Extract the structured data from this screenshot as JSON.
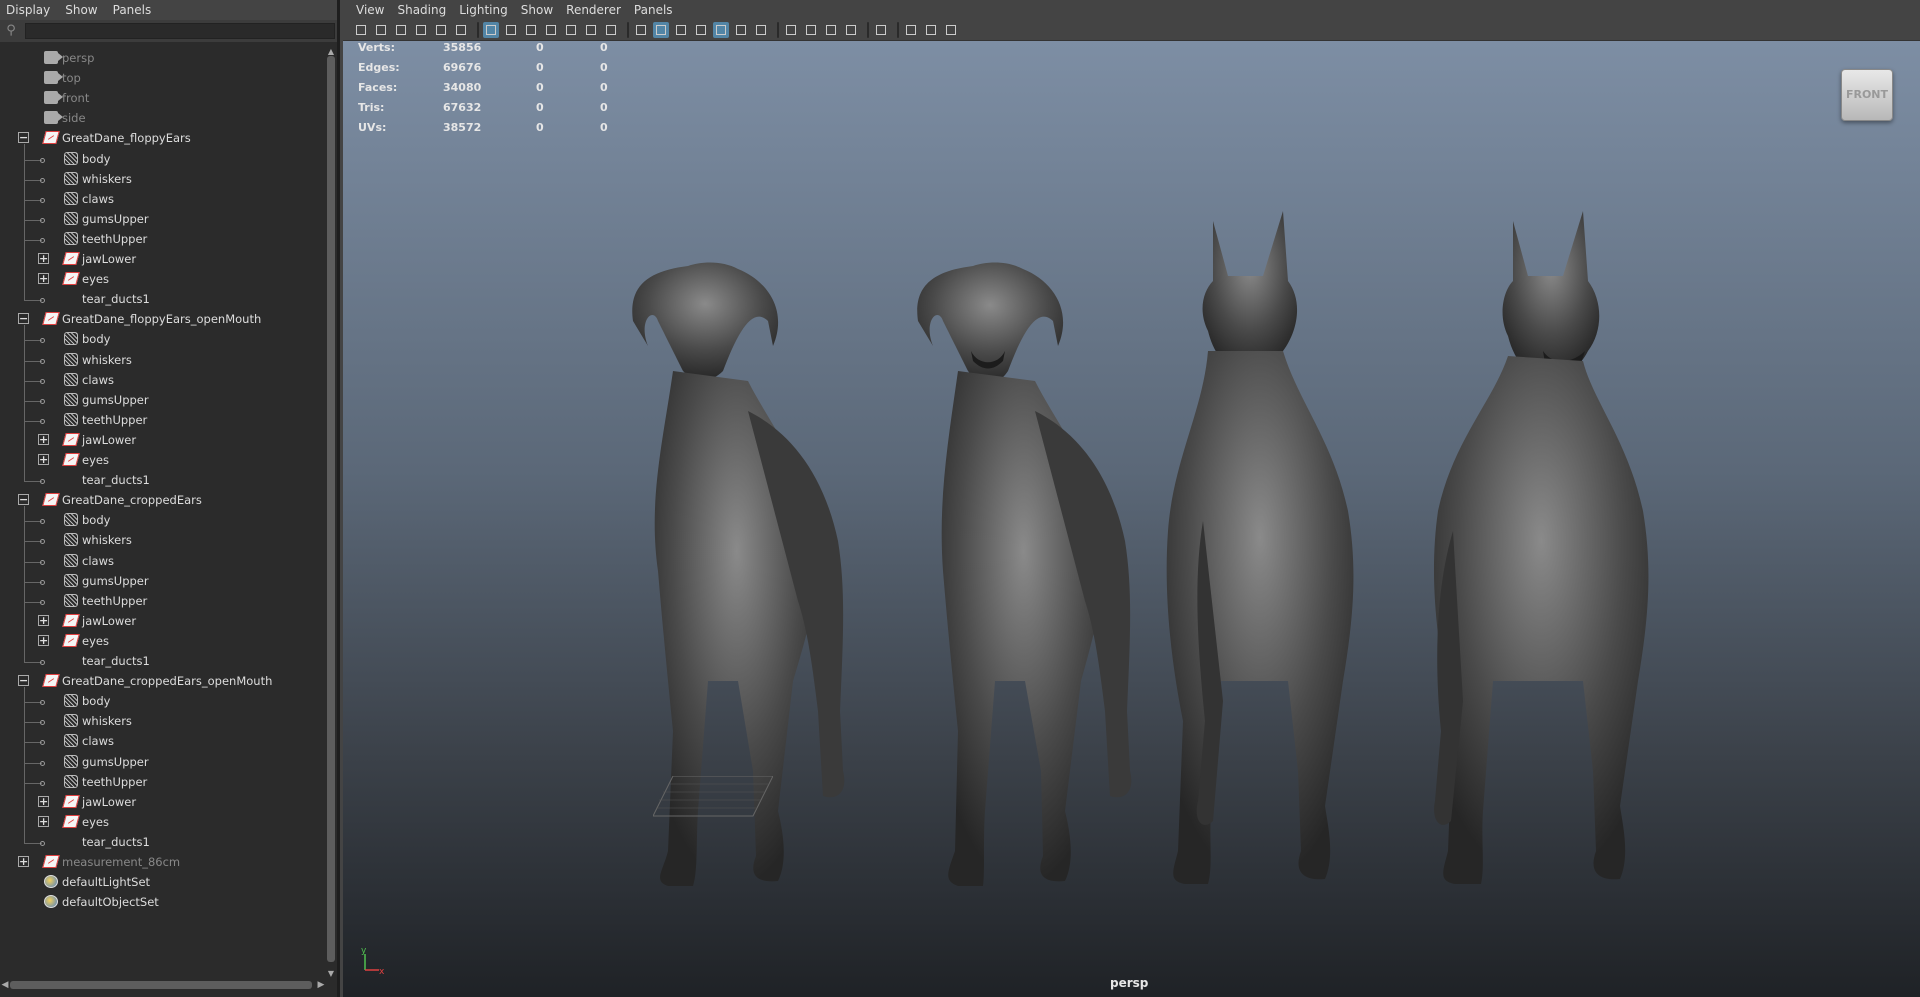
{
  "outliner": {
    "menu": [
      "Display",
      "Show",
      "Panels"
    ],
    "filter_placeholder": "",
    "items": [
      {
        "label": "persp",
        "icon": "camera-icon",
        "indent": 0,
        "expander": "",
        "grey": true
      },
      {
        "label": "top",
        "icon": "camera-icon",
        "indent": 0,
        "expander": "",
        "grey": true
      },
      {
        "label": "front",
        "icon": "camera-icon",
        "indent": 0,
        "expander": "",
        "grey": true
      },
      {
        "label": "side",
        "icon": "camera-icon",
        "indent": 0,
        "expander": "",
        "grey": true
      },
      {
        "label": "GreatDane_floppyEars",
        "icon": "transform-icon",
        "indent": 0,
        "expander": "−",
        "grey": false
      },
      {
        "label": "body",
        "icon": "mesh-icon",
        "indent": 1,
        "expander": "",
        "grey": false
      },
      {
        "label": "whiskers",
        "icon": "mesh-icon",
        "indent": 1,
        "expander": "",
        "grey": false
      },
      {
        "label": "claws",
        "icon": "mesh-icon",
        "indent": 1,
        "expander": "",
        "grey": false
      },
      {
        "label": "gumsUpper",
        "icon": "mesh-icon",
        "indent": 1,
        "expander": "",
        "grey": false
      },
      {
        "label": "teethUpper",
        "icon": "mesh-icon",
        "indent": 1,
        "expander": "",
        "grey": false
      },
      {
        "label": "jawLower",
        "icon": "transform-icon",
        "indent": 1,
        "expander": "+",
        "grey": false
      },
      {
        "label": "eyes",
        "icon": "transform-icon",
        "indent": 1,
        "expander": "+",
        "grey": false
      },
      {
        "label": "tear_ducts1",
        "icon": "",
        "indent": 1,
        "expander": "",
        "grey": false
      },
      {
        "label": "GreatDane_floppyEars_openMouth",
        "icon": "transform-icon",
        "indent": 0,
        "expander": "−",
        "grey": false
      },
      {
        "label": "body",
        "icon": "mesh-icon",
        "indent": 1,
        "expander": "",
        "grey": false
      },
      {
        "label": "whiskers",
        "icon": "mesh-icon",
        "indent": 1,
        "expander": "",
        "grey": false
      },
      {
        "label": "claws",
        "icon": "mesh-icon",
        "indent": 1,
        "expander": "",
        "grey": false
      },
      {
        "label": "gumsUpper",
        "icon": "mesh-icon",
        "indent": 1,
        "expander": "",
        "grey": false
      },
      {
        "label": "teethUpper",
        "icon": "mesh-icon",
        "indent": 1,
        "expander": "",
        "grey": false
      },
      {
        "label": "jawLower",
        "icon": "transform-icon",
        "indent": 1,
        "expander": "+",
        "grey": false
      },
      {
        "label": "eyes",
        "icon": "transform-icon",
        "indent": 1,
        "expander": "+",
        "grey": false
      },
      {
        "label": "tear_ducts1",
        "icon": "",
        "indent": 1,
        "expander": "",
        "grey": false
      },
      {
        "label": "GreatDane_croppedEars",
        "icon": "transform-icon",
        "indent": 0,
        "expander": "−",
        "grey": false
      },
      {
        "label": "body",
        "icon": "mesh-icon",
        "indent": 1,
        "expander": "",
        "grey": false
      },
      {
        "label": "whiskers",
        "icon": "mesh-icon",
        "indent": 1,
        "expander": "",
        "grey": false
      },
      {
        "label": "claws",
        "icon": "mesh-icon",
        "indent": 1,
        "expander": "",
        "grey": false
      },
      {
        "label": "gumsUpper",
        "icon": "mesh-icon",
        "indent": 1,
        "expander": "",
        "grey": false
      },
      {
        "label": "teethUpper",
        "icon": "mesh-icon",
        "indent": 1,
        "expander": "",
        "grey": false
      },
      {
        "label": "jawLower",
        "icon": "transform-icon",
        "indent": 1,
        "expander": "+",
        "grey": false
      },
      {
        "label": "eyes",
        "icon": "transform-icon",
        "indent": 1,
        "expander": "+",
        "grey": false
      },
      {
        "label": "tear_ducts1",
        "icon": "",
        "indent": 1,
        "expander": "",
        "grey": false
      },
      {
        "label": "GreatDane_croppedEars_openMouth",
        "icon": "transform-icon",
        "indent": 0,
        "expander": "−",
        "grey": false
      },
      {
        "label": "body",
        "icon": "mesh-icon",
        "indent": 1,
        "expander": "",
        "grey": false
      },
      {
        "label": "whiskers",
        "icon": "mesh-icon",
        "indent": 1,
        "expander": "",
        "grey": false
      },
      {
        "label": "claws",
        "icon": "mesh-icon",
        "indent": 1,
        "expander": "",
        "grey": false
      },
      {
        "label": "gumsUpper",
        "icon": "mesh-icon",
        "indent": 1,
        "expander": "",
        "grey": false
      },
      {
        "label": "teethUpper",
        "icon": "mesh-icon",
        "indent": 1,
        "expander": "",
        "grey": false
      },
      {
        "label": "jawLower",
        "icon": "transform-icon",
        "indent": 1,
        "expander": "+",
        "grey": false
      },
      {
        "label": "eyes",
        "icon": "transform-icon",
        "indent": 1,
        "expander": "+",
        "grey": false
      },
      {
        "label": "tear_ducts1",
        "icon": "",
        "indent": 1,
        "expander": "",
        "grey": false
      },
      {
        "label": "measurement_86cm",
        "icon": "transform-icon",
        "indent": 0,
        "expander": "+",
        "grey": true
      },
      {
        "label": "defaultLightSet",
        "icon": "set-icon",
        "indent": 0,
        "expander": "",
        "grey": false
      },
      {
        "label": "defaultObjectSet",
        "icon": "set-icon",
        "indent": 0,
        "expander": "",
        "grey": false
      }
    ]
  },
  "viewport": {
    "menu": [
      "View",
      "Shading",
      "Lighting",
      "Show",
      "Renderer",
      "Panels"
    ],
    "hud": [
      {
        "label": "Verts:",
        "v1": "35856",
        "v2": "0",
        "v3": "0"
      },
      {
        "label": "Edges:",
        "v1": "69676",
        "v2": "0",
        "v3": "0"
      },
      {
        "label": "Faces:",
        "v1": "34080",
        "v2": "0",
        "v3": "0"
      },
      {
        "label": "Tris:",
        "v1": "67632",
        "v2": "0",
        "v3": "0"
      },
      {
        "label": "UVs:",
        "v1": "38572",
        "v2": "0",
        "v3": "0"
      }
    ],
    "viewcube_label": "FRONT",
    "camera_name": "persp",
    "axis_y": "y",
    "axis_x": "x"
  },
  "colors": {
    "accent": "#5285a6",
    "transform_icon": "#e04040"
  }
}
